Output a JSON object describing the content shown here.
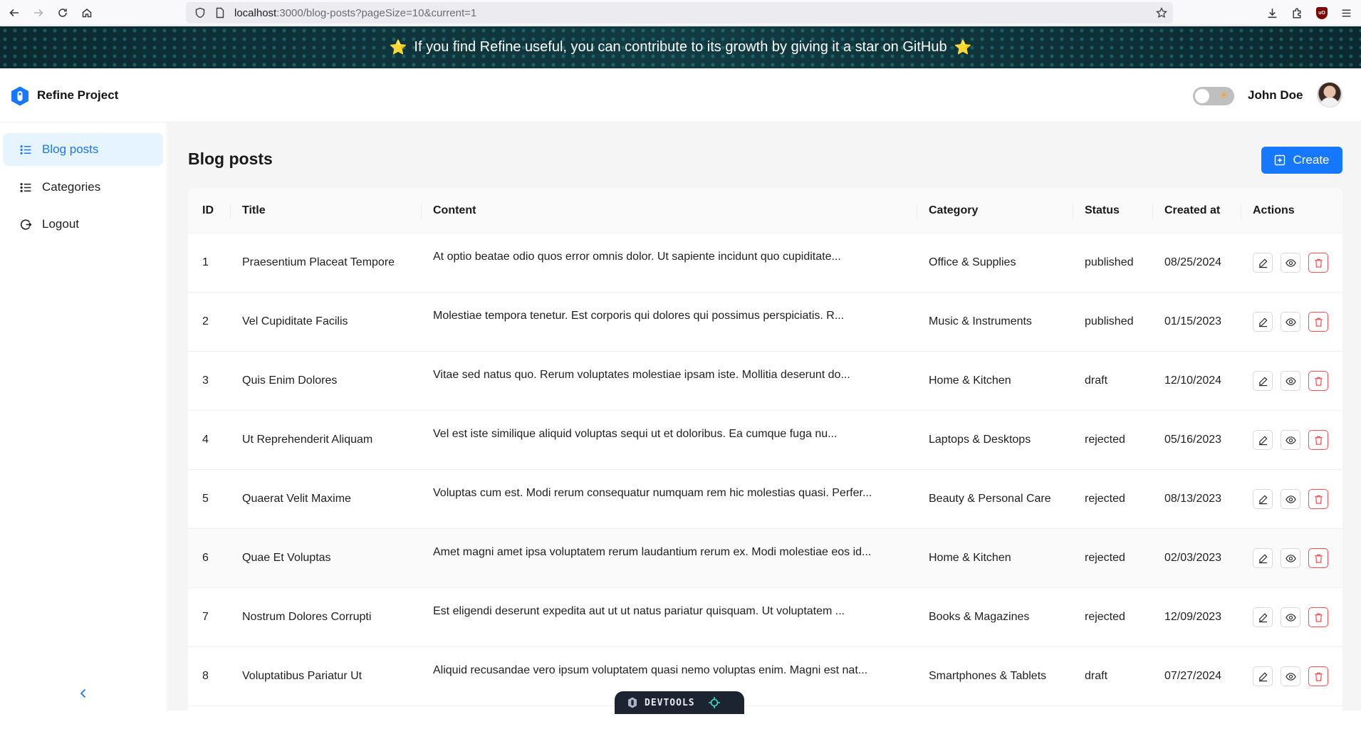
{
  "browser": {
    "url_host": "localhost",
    "url_rest": ":3000/blog-posts?pageSize=10&current=1"
  },
  "banner": {
    "text": "If you find Refine useful, you can contribute to its growth by giving it a star on GitHub",
    "star": "⭐"
  },
  "header": {
    "brand": "Refine Project",
    "username": "John Doe"
  },
  "sidebar": {
    "items": [
      {
        "label": "Blog posts",
        "active": true
      },
      {
        "label": "Categories",
        "active": false
      },
      {
        "label": "Logout",
        "active": false
      }
    ]
  },
  "main": {
    "title": "Blog posts",
    "create_label": "Create"
  },
  "table": {
    "columns": [
      "ID",
      "Title",
      "Content",
      "Category",
      "Status",
      "Created at",
      "Actions"
    ],
    "rows": [
      {
        "id": "1",
        "title": "Praesentium Placeat Tempore",
        "content": "At optio beatae odio quos error omnis dolor. Ut sapiente incidunt quo cupiditate...",
        "category": "Office & Supplies",
        "status": "published",
        "created": "08/25/2024"
      },
      {
        "id": "2",
        "title": "Vel Cupiditate Facilis",
        "content": "Molestiae tempora tenetur. Est corporis qui dolores qui possimus perspiciatis. R...",
        "category": "Music & Instruments",
        "status": "published",
        "created": "01/15/2023"
      },
      {
        "id": "3",
        "title": "Quis Enim Dolores",
        "content": "Vitae sed natus quo. Rerum voluptates molestiae ipsam iste. Mollitia deserunt do...",
        "category": "Home & Kitchen",
        "status": "draft",
        "created": "12/10/2024"
      },
      {
        "id": "4",
        "title": "Ut Reprehenderit Aliquam",
        "content": "Vel est iste similique aliquid voluptas sequi ut et doloribus. Ea cumque fuga nu...",
        "category": "Laptops & Desktops",
        "status": "rejected",
        "created": "05/16/2023"
      },
      {
        "id": "5",
        "title": "Quaerat Velit Maxime",
        "content": "Voluptas cum est. Modi rerum consequatur numquam rem hic molestias quasi. Perfer...",
        "category": "Beauty & Personal Care",
        "status": "rejected",
        "created": "08/13/2023"
      },
      {
        "id": "6",
        "title": "Quae Et Voluptas",
        "content": "Amet magni amet ipsa voluptatem rerum laudantium rerum ex. Modi molestiae eos id...",
        "category": "Home & Kitchen",
        "status": "rejected",
        "created": "02/03/2023"
      },
      {
        "id": "7",
        "title": "Nostrum Dolores Corrupti",
        "content": "Est eligendi deserunt expedita aut ut ut natus pariatur quisquam. Ut voluptatem ...",
        "category": "Books & Magazines",
        "status": "rejected",
        "created": "12/09/2023"
      },
      {
        "id": "8",
        "title": "Voluptatibus Pariatur Ut",
        "content": "Aliquid recusandae vero ipsum voluptatem quasi nemo voluptas enim. Magni est nat...",
        "category": "Smartphones & Tablets",
        "status": "draft",
        "created": "07/27/2024"
      }
    ]
  },
  "devtools": {
    "label": "DEVTOOLS"
  }
}
